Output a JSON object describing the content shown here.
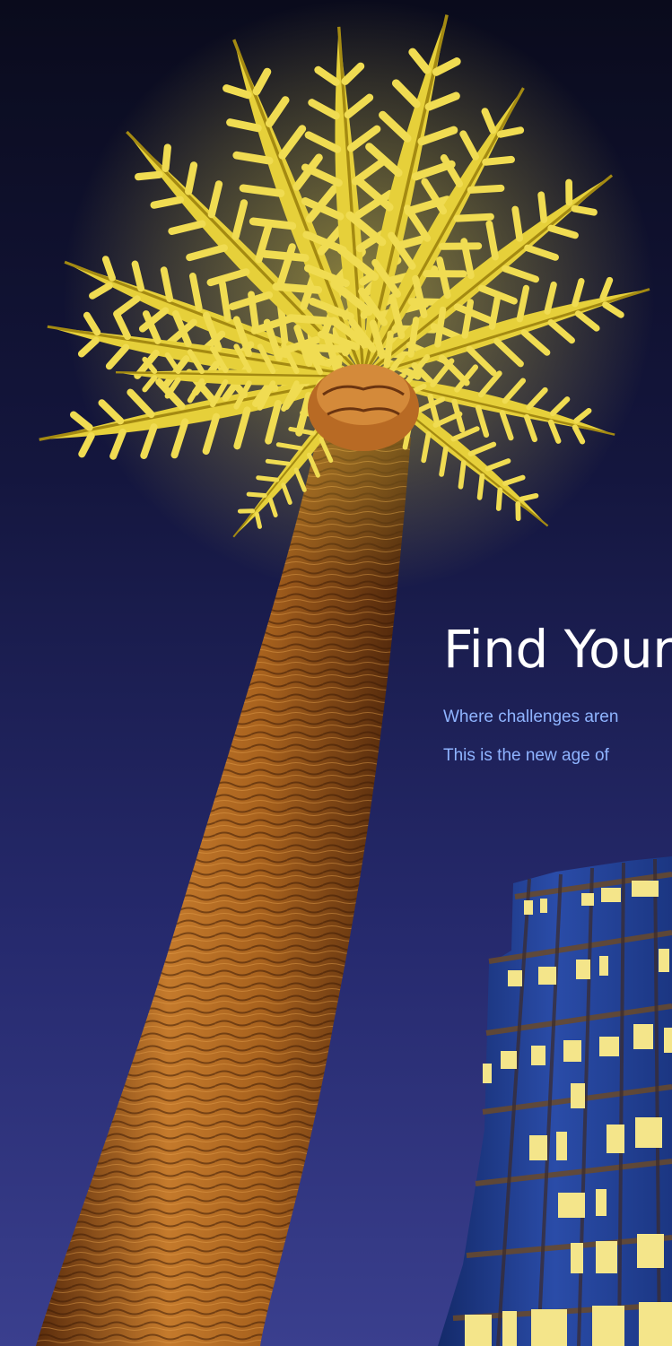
{
  "headline": "Find Your",
  "lines": [
    "Where challenges aren",
    "This is the new age of"
  ],
  "colors": {
    "sky_top": "#0a0b1c",
    "sky_mid": "#1d205a",
    "sky_bottom": "#3a3f8e",
    "frond": "#e8d23a",
    "trunk": "#b56a22",
    "heading_text": "#ffffff",
    "body_text": "#8fb4ff",
    "window_light": "#f4e58a",
    "building_glass": "#1f3a8a"
  }
}
